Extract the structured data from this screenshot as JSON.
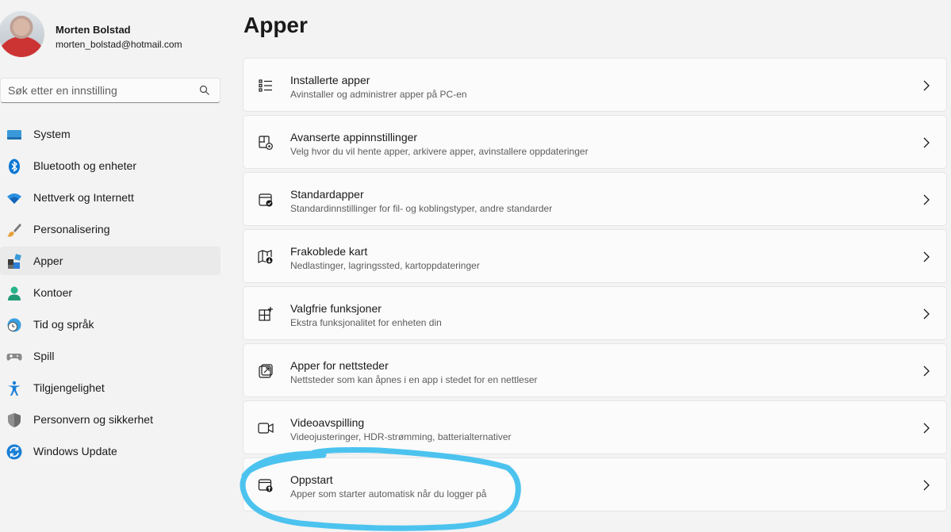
{
  "profile": {
    "name": "Morten Bolstad",
    "email": "morten_bolstad@hotmail.com"
  },
  "search": {
    "placeholder": "Søk etter en innstilling"
  },
  "nav": [
    {
      "label": "System",
      "icon": "system-icon"
    },
    {
      "label": "Bluetooth og enheter",
      "icon": "bluetooth-icon"
    },
    {
      "label": "Nettverk og Internett",
      "icon": "wifi-icon"
    },
    {
      "label": "Personalisering",
      "icon": "brush-icon"
    },
    {
      "label": "Apper",
      "icon": "apps-icon",
      "active": true
    },
    {
      "label": "Kontoer",
      "icon": "person-icon"
    },
    {
      "label": "Tid og språk",
      "icon": "globe-clock-icon"
    },
    {
      "label": "Spill",
      "icon": "gamepad-icon"
    },
    {
      "label": "Tilgjengelighet",
      "icon": "accessibility-icon"
    },
    {
      "label": "Personvern og sikkerhet",
      "icon": "shield-icon"
    },
    {
      "label": "Windows Update",
      "icon": "update-icon"
    }
  ],
  "page": {
    "title": "Apper"
  },
  "cards": [
    {
      "title": "Installerte apper",
      "subtitle": "Avinstaller og administrer apper på PC-en",
      "icon": "list-icon"
    },
    {
      "title": "Avanserte appinnstillinger",
      "subtitle": "Velg hvor du vil hente apper, arkivere apper, avinstallere oppdateringer",
      "icon": "app-settings-icon"
    },
    {
      "title": "Standardapper",
      "subtitle": "Standardinnstillinger for fil- og koblingstyper, andre standarder",
      "icon": "default-apps-icon"
    },
    {
      "title": "Frakoblede kart",
      "subtitle": "Nedlastinger, lagringssted, kartoppdateringer",
      "icon": "map-icon"
    },
    {
      "title": "Valgfrie funksjoner",
      "subtitle": "Ekstra funksjonalitet for enheten din",
      "icon": "optional-features-icon"
    },
    {
      "title": "Apper for nettsteder",
      "subtitle": "Nettsteder som kan åpnes i en app i stedet for en nettleser",
      "icon": "open-link-icon"
    },
    {
      "title": "Videoavspilling",
      "subtitle": "Videojusteringer, HDR-strømming, batterialternativer",
      "icon": "video-icon"
    },
    {
      "title": "Oppstart",
      "subtitle": "Apper som starter automatisk når du logger på",
      "icon": "startup-icon"
    }
  ],
  "colors": {
    "accent": "#0067c0",
    "highlight": "#4cc3ee",
    "background": "#f3f3f3",
    "card": "#fbfbfb"
  }
}
